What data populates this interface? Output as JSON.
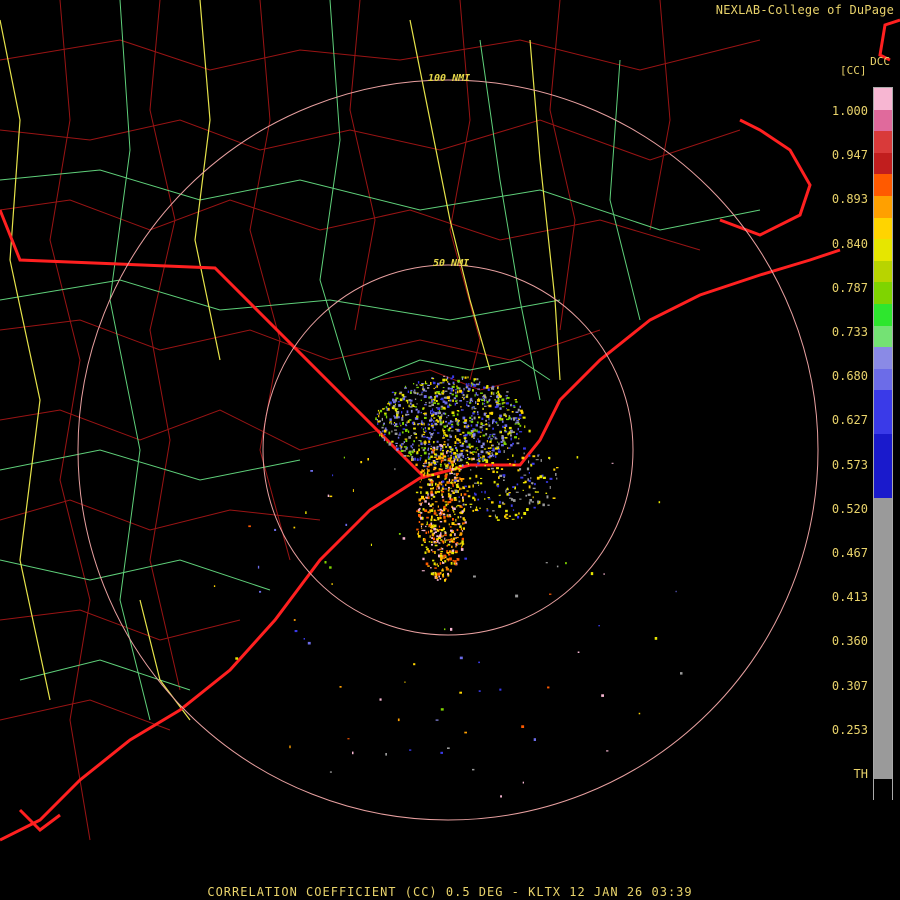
{
  "credit": "NEXLAB-College of DuPage",
  "product_code": "DCC",
  "scale_unit": "[CC]",
  "range_rings": [
    {
      "label": "100 NMI"
    },
    {
      "label": "50 NMI"
    }
  ],
  "legend": {
    "ticks": [
      "1.000",
      "0.947",
      "0.893",
      "0.840",
      "0.787",
      "0.733",
      "0.680",
      "0.627",
      "0.573",
      "0.520",
      "0.467",
      "0.413",
      "0.360",
      "0.307",
      "0.253",
      "TH"
    ],
    "colors": [
      "#f7b6d2",
      "#e06a9c",
      "#d93a3a",
      "#c11e1e",
      "#ff5a00",
      "#ffa000",
      "#ffd400",
      "#e6e600",
      "#b8d400",
      "#7fd400",
      "#2ee62e",
      "#74e274",
      "#8a8ae6",
      "#6c6ce8",
      "#3a3ae8",
      "#1a1acc",
      "#9a9a9a",
      "#000000"
    ]
  },
  "footer": "CORRELATION COEFFICIENT (CC) 0.5 DEG - KLTX 12 JAN 26 03:39"
}
